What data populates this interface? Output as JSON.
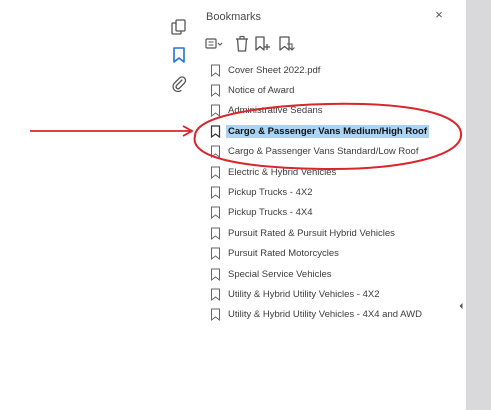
{
  "panel": {
    "title": "Bookmarks",
    "close_glyph": "×"
  },
  "left_rail": {
    "icons": [
      "pages-thumbnail-icon",
      "bookmark-icon",
      "attachment-paperclip-icon"
    ]
  },
  "toolbar": {
    "icons": [
      "options-menu-icon",
      "delete-bookmark-icon",
      "new-bookmark-icon",
      "new-bookmark-from-structure-icon"
    ]
  },
  "bookmarks": [
    {
      "label": "Cover Sheet 2022.pdf"
    },
    {
      "label": "Notice of Award"
    },
    {
      "label": "Administrative Sedans"
    },
    {
      "label": "Cargo & Passenger Vans Medium/High Roof"
    },
    {
      "label": "Cargo & Passenger Vans Standard/Low Roof"
    },
    {
      "label": "Electric & Hybrid Vehicles"
    },
    {
      "label": "Pickup Trucks - 4X2"
    },
    {
      "label": "Pickup Trucks - 4X4"
    },
    {
      "label": "Pursuit Rated & Pursuit Hybrid Vehicles"
    },
    {
      "label": "Pursuit Rated Motorcycles"
    },
    {
      "label": "Special Service Vehicles"
    },
    {
      "label": "Utility & Hybrid Utility Vehicles - 4X2"
    },
    {
      "label": "Utility & Hybrid Utility Vehicles - 4X4 and AWD"
    }
  ],
  "selected_bookmark": "Cargo & Passenger Vans Medium/High Roof",
  "colors": {
    "annotation_red": "#d9262c",
    "selection_blue": "#a9d4f5",
    "active_icon_blue": "#1e73d6",
    "gutter_gray": "#d9d9db"
  }
}
